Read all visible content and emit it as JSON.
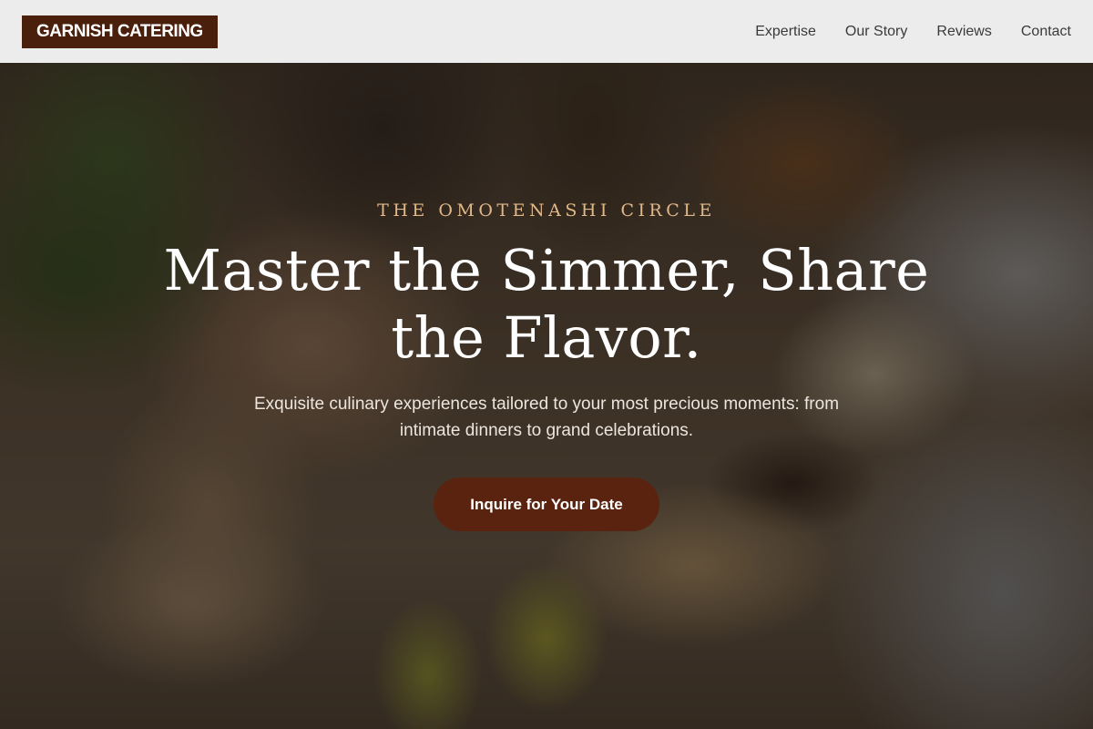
{
  "header": {
    "logo_text": "GARNISH CATERING",
    "nav": [
      {
        "label": "Expertise"
      },
      {
        "label": "Our Story"
      },
      {
        "label": "Reviews"
      },
      {
        "label": "Contact"
      }
    ]
  },
  "hero": {
    "eyebrow": "THE OMOTENASHI CIRCLE",
    "headline": "Master the Simmer, Share the Flavor.",
    "subtext": "Exquisite culinary experiences tailored to your most precious moments: from intimate dinners to grand celebrations.",
    "cta_label": "Inquire for Your Date"
  },
  "colors": {
    "brand_brown": "#4a1f0c",
    "cta_brown": "#5a230f",
    "eyebrow_gold": "#e0b889",
    "header_bg": "#ececec"
  }
}
